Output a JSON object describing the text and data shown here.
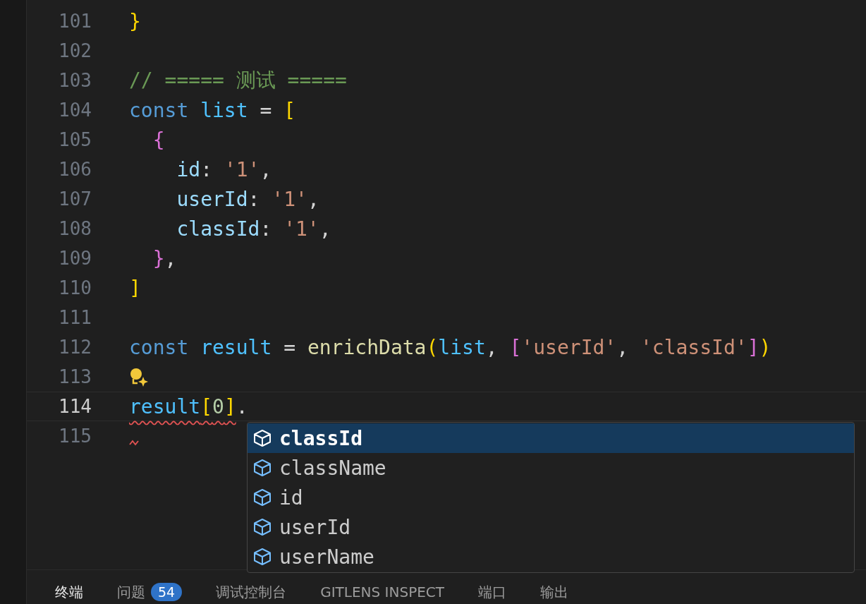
{
  "editor": {
    "lines": [
      {
        "number": "101",
        "current": false,
        "lightbulb": false,
        "squiggle": false,
        "tokens": [
          {
            "kind": "bracket1",
            "text": "}"
          }
        ]
      },
      {
        "number": "102",
        "current": false,
        "lightbulb": false,
        "squiggle": false
      },
      {
        "number": "103",
        "current": false,
        "lightbulb": false,
        "squiggle": false,
        "tokens": [
          {
            "kind": "comment",
            "text": "// ===== 测试 ====="
          }
        ]
      },
      {
        "number": "104",
        "current": false,
        "lightbulb": false,
        "squiggle": false,
        "tokens": [
          {
            "kind": "keyword",
            "text": "const "
          },
          {
            "kind": "variable",
            "text": "list"
          },
          {
            "kind": "plain",
            "text": " = "
          },
          {
            "kind": "bracket1",
            "text": "["
          }
        ]
      },
      {
        "number": "105",
        "current": false,
        "lightbulb": false,
        "squiggle": false,
        "tokens": [
          {
            "kind": "bracket2",
            "text": "  {"
          }
        ]
      },
      {
        "number": "106",
        "current": false,
        "lightbulb": false,
        "squiggle": false,
        "tokens": [
          {
            "kind": "property",
            "text": "    id"
          },
          {
            "kind": "plain",
            "text": ": "
          },
          {
            "kind": "string",
            "text": "'1'"
          },
          {
            "kind": "plain",
            "text": ","
          }
        ]
      },
      {
        "number": "107",
        "current": false,
        "lightbulb": false,
        "squiggle": false,
        "tokens": [
          {
            "kind": "property",
            "text": "    userId"
          },
          {
            "kind": "plain",
            "text": ": "
          },
          {
            "kind": "string",
            "text": "'1'"
          },
          {
            "kind": "plain",
            "text": ","
          }
        ]
      },
      {
        "number": "108",
        "current": false,
        "lightbulb": false,
        "squiggle": false,
        "tokens": [
          {
            "kind": "property",
            "text": "    classId"
          },
          {
            "kind": "plain",
            "text": ": "
          },
          {
            "kind": "string",
            "text": "'1'"
          },
          {
            "kind": "plain",
            "text": ","
          }
        ]
      },
      {
        "number": "109",
        "current": false,
        "lightbulb": false,
        "squiggle": false,
        "tokens": [
          {
            "kind": "bracket2",
            "text": "  }"
          },
          {
            "kind": "plain",
            "text": ","
          }
        ]
      },
      {
        "number": "110",
        "current": false,
        "lightbulb": false,
        "squiggle": false,
        "tokens": [
          {
            "kind": "bracket1",
            "text": "]"
          }
        ]
      },
      {
        "number": "111",
        "current": false,
        "lightbulb": false,
        "squiggle": false
      },
      {
        "number": "112",
        "current": false,
        "lightbulb": false,
        "squiggle": false,
        "tokens": [
          {
            "kind": "keyword",
            "text": "const "
          },
          {
            "kind": "variable",
            "text": "result"
          },
          {
            "kind": "plain",
            "text": " = "
          },
          {
            "kind": "function",
            "text": "enrichData"
          },
          {
            "kind": "bracket1",
            "text": "("
          },
          {
            "kind": "variable",
            "text": "list"
          },
          {
            "kind": "plain",
            "text": ", "
          },
          {
            "kind": "bracket2",
            "text": "["
          },
          {
            "kind": "string",
            "text": "'userId'"
          },
          {
            "kind": "plain",
            "text": ", "
          },
          {
            "kind": "string",
            "text": "'classId'"
          },
          {
            "kind": "bracket2",
            "text": "]"
          },
          {
            "kind": "bracket1",
            "text": ")"
          }
        ]
      },
      {
        "number": "113",
        "current": false,
        "lightbulb": true,
        "squiggle": false
      },
      {
        "number": "114",
        "current": true,
        "lightbulb": false,
        "squiggle": false,
        "tokens": [
          {
            "kind": "variable",
            "text": "result",
            "error": true
          },
          {
            "kind": "bracket1",
            "text": "[",
            "error": true
          },
          {
            "kind": "number",
            "text": "0",
            "error": true
          },
          {
            "kind": "bracket1",
            "text": "]",
            "error": true
          },
          {
            "kind": "plain",
            "text": "."
          }
        ]
      },
      {
        "number": "115",
        "current": false,
        "lightbulb": false,
        "squiggle": true
      }
    ]
  },
  "suggestions": [
    {
      "label": "classId",
      "selected": true
    },
    {
      "label": "className",
      "selected": false
    },
    {
      "label": "id",
      "selected": false
    },
    {
      "label": "userId",
      "selected": false
    },
    {
      "label": "userName",
      "selected": false
    }
  ],
  "panel": {
    "tabs": [
      {
        "label": "终端",
        "selected": true
      },
      {
        "label": "问题",
        "selected": false,
        "badge": "54"
      },
      {
        "label": "调试控制台",
        "selected": false
      },
      {
        "label": "GITLENS INSPECT",
        "selected": false
      },
      {
        "label": "端口",
        "selected": false
      },
      {
        "label": "输出",
        "selected": false
      }
    ]
  }
}
